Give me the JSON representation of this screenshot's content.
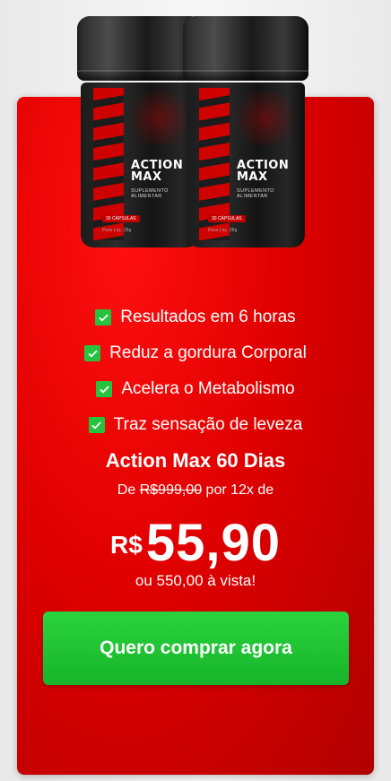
{
  "product": {
    "brand_line1": "ACTION",
    "brand_line2": "MAX",
    "subtitle": "SUPLEMENTO ALIMENTAR",
    "capsules": "30 CÁPSULAS",
    "weight": "Peso Líq.: 28g"
  },
  "benefits": [
    {
      "icon": "check-icon",
      "label": "Resultados em 6 horas"
    },
    {
      "icon": "check-icon",
      "label": "Reduz a gordura Corporal"
    },
    {
      "icon": "check-icon",
      "label": "Acelera o Metabolismo"
    },
    {
      "icon": "check-icon",
      "label": "Traz sensação de leveza"
    }
  ],
  "offer": {
    "title": "Action Max 60 Dias",
    "from_prefix": "De ",
    "old_price": "R$999,00",
    "from_suffix": " por 12x de",
    "currency": "R$",
    "installment_value": "55,90",
    "cash_price": "ou 550,00 à vista!",
    "buy_label": "Quero comprar agora"
  },
  "colors": {
    "card_red": "#e00000",
    "check_green": "#26c33f",
    "button_green": "#1fc332"
  }
}
